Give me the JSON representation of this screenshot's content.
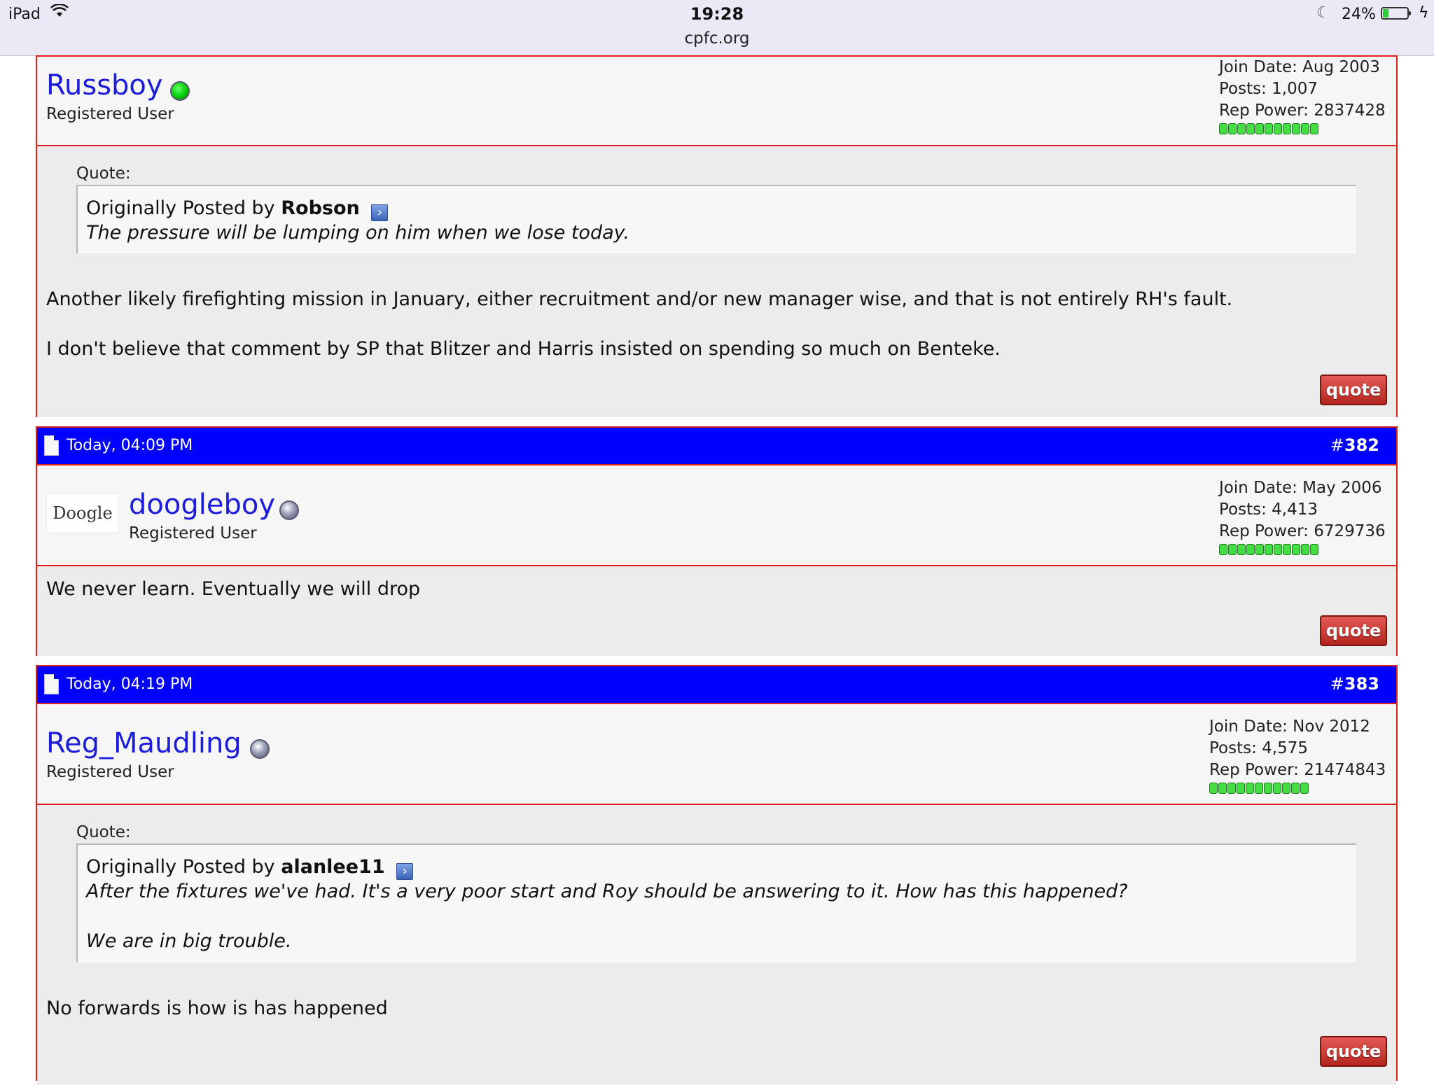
{
  "status_bar": {
    "device": "iPad",
    "time": "19:28",
    "url": "cpfc.org",
    "battery": "24%",
    "battery_level": 0.24,
    "icons": [
      "wifi-icon",
      "moon-icon",
      "battery-icon",
      "charging-bolt-icon"
    ]
  },
  "posts": [
    {
      "username": "Russboy",
      "online": true,
      "user_title": "Registered User",
      "join_date": "Join Date: Aug 2003",
      "posts": "Posts: 1,007",
      "rep_power": "Rep Power: 2837428",
      "quote_label": "Quote:",
      "quote_prefix": "Originally Posted by",
      "quote_author": "Robson",
      "quote_lines": [
        "The pressure will be lumping on him when we lose today."
      ],
      "message_lines": [
        "Another likely firefighting mission in January, either recruitment and/or new manager wise, and that is not entirely RH's fault.",
        "I don't believe that comment by SP that Blitzer and Harris insisted on spending so much on Benteke."
      ],
      "quote_button": "quote"
    },
    {
      "timestamp": "Today, 04:09 PM",
      "number_hash": "#",
      "number": "382",
      "username": "doogleboy",
      "online": false,
      "avatar_text": "Doogle",
      "user_title": "Registered User",
      "join_date": "Join Date: May 2006",
      "posts": "Posts: 4,413",
      "rep_power": "Rep Power: 6729736",
      "message_lines": [
        "We never learn. Eventually we will drop"
      ],
      "quote_button": "quote"
    },
    {
      "timestamp": "Today, 04:19 PM",
      "number_hash": "#",
      "number": "383",
      "username": "Reg_Maudling",
      "online": false,
      "user_title": "Registered User",
      "join_date": "Join Date: Nov 2012",
      "posts": "Posts: 4,575",
      "rep_power": "Rep Power: 21474843",
      "quote_label": "Quote:",
      "quote_prefix": "Originally Posted by",
      "quote_author": "alanlee11",
      "quote_lines": [
        "After the fixtures we've had. It's a very poor start and Roy should be answering to it. How has this happened?",
        "We are in big trouble."
      ],
      "message_lines": [
        "No forwards is how is has happened"
      ],
      "quote_button": "quote"
    }
  ],
  "colors": {
    "post_header_bg": "#0000ff",
    "post_border": "#e02020",
    "username": "#1c1cdb",
    "quote_button": "#c0302a",
    "rep_green": "#44dd44"
  }
}
